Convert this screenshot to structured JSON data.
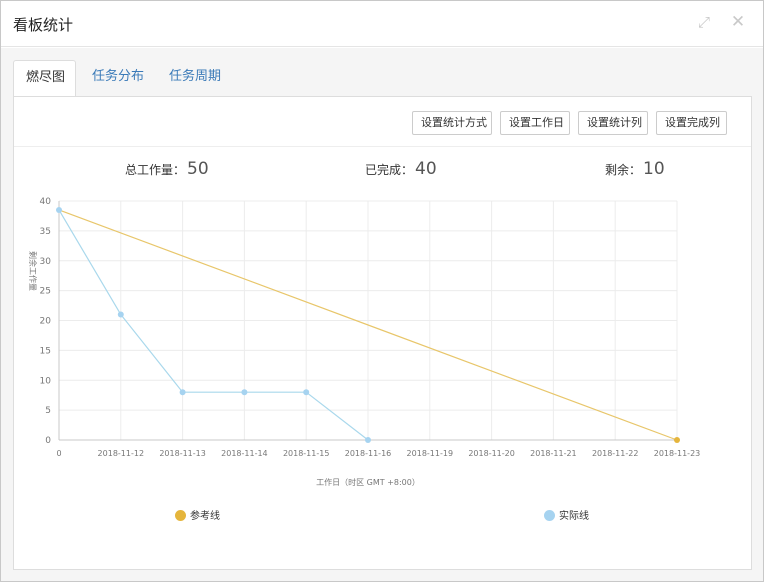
{
  "window": {
    "title": "看板统计",
    "maximize_icon": "expand-icon",
    "close_icon": "close-icon"
  },
  "tabs": [
    {
      "label": "燃尽图",
      "active": true
    },
    {
      "label": "任务分布",
      "active": false
    },
    {
      "label": "任务周期",
      "active": false
    }
  ],
  "toolbar": {
    "buttons": [
      "设置统计方式",
      "设置工作日",
      "设置统计列",
      "设置完成列"
    ]
  },
  "stats": {
    "total_label": "总工作量：",
    "total_value": "50",
    "done_label": "已完成：",
    "done_value": "40",
    "remain_label": "剩余：",
    "remain_value": "10"
  },
  "colors": {
    "reference": "#e8c66a",
    "actual": "#a9d8ec",
    "reference_dot": "#e5b53c",
    "actual_dot": "#a6d3f0",
    "link": "#3a7ab8"
  },
  "chart_data": {
    "type": "line",
    "x": [
      "0",
      "2018-11-12",
      "2018-11-13",
      "2018-11-14",
      "2018-11-15",
      "2018-11-16",
      "2018-11-19",
      "2018-11-20",
      "2018-11-21",
      "2018-11-22",
      "2018-11-23"
    ],
    "xlabel": "工作日（时区 GMT +8:00）",
    "ylabel": "剩余工作量",
    "ylim": [
      0,
      40
    ],
    "yticks": [
      0,
      5,
      10,
      15,
      20,
      25,
      30,
      35,
      40
    ],
    "grid": true,
    "series": [
      {
        "name": "参考线",
        "values": [
          38.5,
          null,
          null,
          null,
          null,
          null,
          null,
          null,
          null,
          null,
          0
        ]
      },
      {
        "name": "实际线",
        "values": [
          38.5,
          21,
          8,
          8,
          8,
          0,
          null,
          null,
          null,
          null,
          null
        ]
      }
    ],
    "legend": [
      "参考线",
      "实际线"
    ],
    "legend_position": "bottom"
  }
}
